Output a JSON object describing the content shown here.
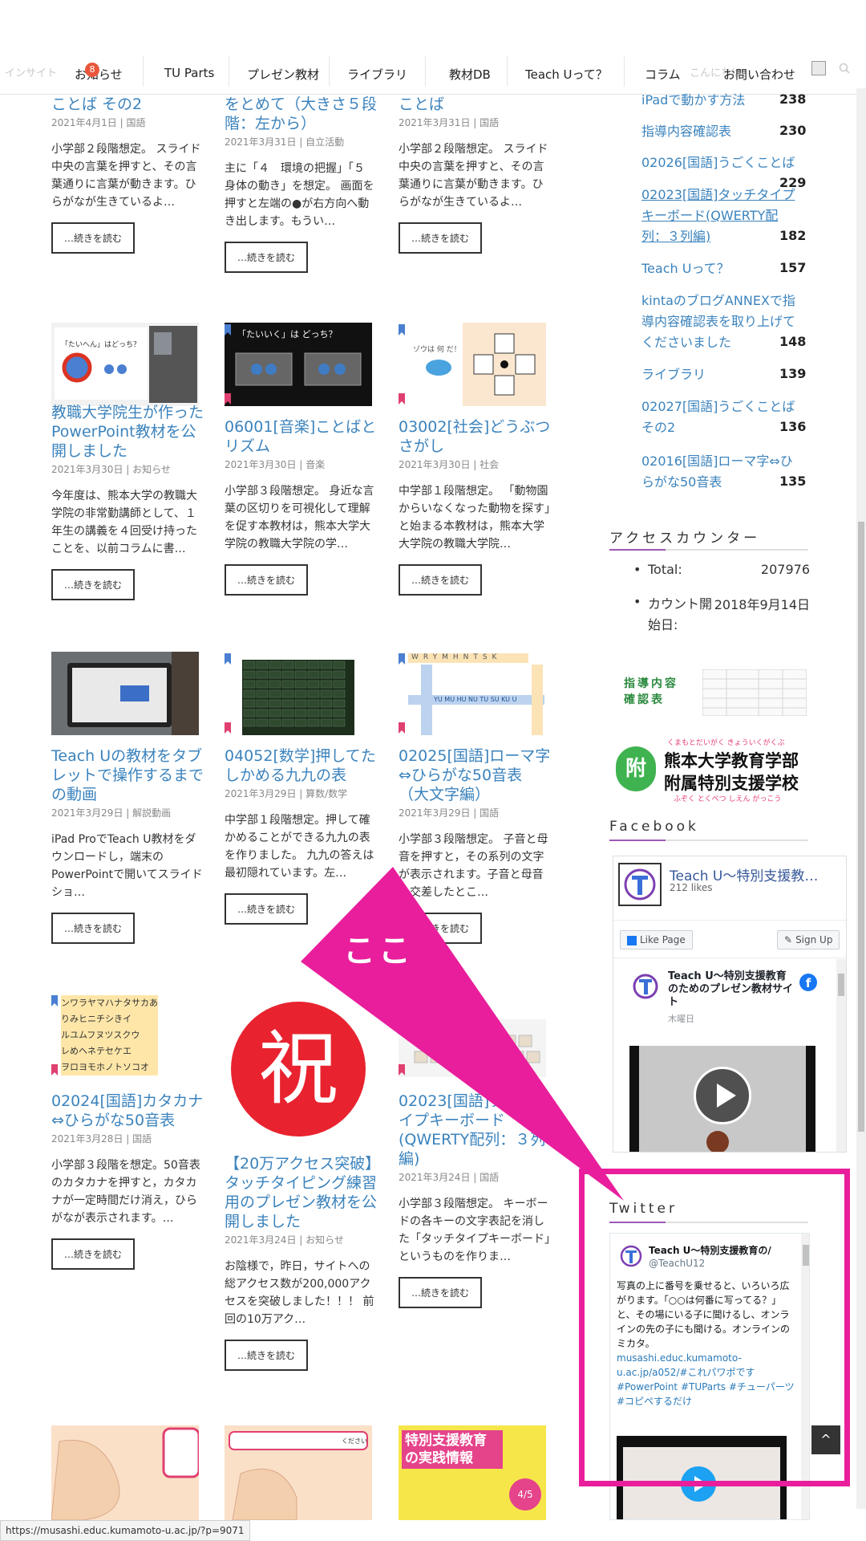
{
  "nav": {
    "items": [
      "お知らせ",
      "TU Parts",
      "プレゼン教材",
      "ライブラリ",
      "教材DB",
      "Teach Uって？",
      "コラム",
      "お問い合わせ"
    ],
    "badge": "8",
    "faint_left": "インサイト",
    "faint_right": "こんにちは、"
  },
  "posts": [
    {
      "title": "ことば その2",
      "date": "2021年4月1日",
      "cat": "国語",
      "excerpt": "小学部２段階想定。 スライド中央の言葉を押すと、その言葉通りに言葉が動きます。ひらがなが生きているよ…"
    },
    {
      "title": "をとめて（大きさ５段階：左から）",
      "date": "2021年3月31日",
      "cat": "自立活動",
      "excerpt": "主に「４　環境の把握」「５　身体の動き」を想定。 画面を押すと左端の●が右方向へ動き出します。もうい…"
    },
    {
      "title": "ことば",
      "date": "2021年3月31日",
      "cat": "国語",
      "excerpt": "小学部２段階想定。 スライド中央の言葉を押すと、その言葉通りに言葉が動きます。ひらがなが生きているよ…"
    },
    {
      "title": "教職大学院生が作ったPowerPoint教材を公開しました",
      "date": "2021年3月30日",
      "cat": "お知らせ",
      "excerpt": "今年度は、熊本大学の教職大学院の非常勤講師として、１年生の講義を４回受け持ったことを、以前コラムに書…"
    },
    {
      "title": "06001[音楽]ことばとリズム",
      "date": "2021年3月30日",
      "cat": "音楽",
      "excerpt": "小学部３段階想定。 身近な言葉の区切りを可視化して理解を促す本教材は，熊本大学大学院の教職大学院の学…"
    },
    {
      "title": "03002[社会]どうぶつさがし",
      "date": "2021年3月30日",
      "cat": "社会",
      "excerpt": "中学部１段階想定。 「動物園からいなくなった動物を探す」と始まる本教材は，熊本大学大学院の教職大学院…"
    },
    {
      "title": "Teach Uの教材をタブレットで操作するまでの動画",
      "date": "2021年3月29日",
      "cat": "解説動画",
      "excerpt": "iPad ProでTeach U教材をダウンロードし，端末のPowerPointで開いてスライドショ…"
    },
    {
      "title": "04052[数学]押してたしかめる九九の表",
      "date": "2021年3月29日",
      "cat": "算数/数学",
      "excerpt": "中学部１段階想定。押して確かめることができる九九の表を作りました。 九九の答えは最初隠れています。左…"
    },
    {
      "title": "02025[国語]ローマ字⇔ひらがな50音表（大文字編）",
      "date": "2021年3月29日",
      "cat": "国語",
      "excerpt": "小学部３段階想定。 子音と母音を押すと，その系列の文字が表示されます。子音と母音の交差したとこ…"
    },
    {
      "title": "02024[国語]カタカナ⇔ひらがな50音表",
      "date": "2021年3月28日",
      "cat": "国語",
      "excerpt": "小学部３段階を想定。50音表のカタカナを押すと，カタカナが一定時間だけ消え，ひらがなが表示されます。…"
    },
    {
      "title": "【20万アクセス突破】タッチタイピング練習用のプレゼン教材を公開しました",
      "date": "2021年3月24日",
      "cat": "お知らせ",
      "excerpt": "お陰様で，昨日，サイトへの総アクセス数が200,000アクセスを突破しました！！！ 前回の10万アク…"
    },
    {
      "title": "02023[国語]タッチタイプキーボード(QWERTY配列：３列編)",
      "date": "2021年3月24日",
      "cat": "国語",
      "excerpt": "小学部３段階想定。 キーボードの各キーの文字表記を消した「タッチタイプキーボード」というものを作りま…"
    }
  ],
  "read_more": "…続きを読む",
  "thumbs": {
    "t1_caption": "「たいへん」はどっち？",
    "t2_caption": "「たいいく」は どっち？",
    "t3_caption": "ゾウは 何 だ！",
    "iwai": "祝",
    "roma_top": "WRYMHNTSK",
    "roma_mid": "YU MU HU NU TU SU KU U",
    "kana_rows": [
      "ンワラヤマハナタサカあ",
      "りみヒニチシきイ",
      "ルユムフヌツスクウ",
      "レめヘネテセケエ",
      "ヲロヨモホノトソコオ"
    ],
    "bottom_bubble": "ください",
    "bottom_book": "特別支援教育の実践情報",
    "bottom_book_date": "4/5"
  },
  "sidebar": {
    "popular": [
      {
        "title": "iPadで動かす方法",
        "count": "238"
      },
      {
        "title": "指導内容確認表",
        "count": "230"
      },
      {
        "title": "02026[国語]うごくことば",
        "count": "229"
      },
      {
        "title": "02023[国語]タッチタイプキーボード(QWERTY配列：３列編)",
        "count": "182"
      },
      {
        "title": "Teach Uって？",
        "count": "157"
      },
      {
        "title": "kintaのブログANNEXで指導内容確認表を取り上げてくださいました",
        "count": "148"
      },
      {
        "title": "ライブラリ",
        "count": "139"
      },
      {
        "title": "02027[国語]うごくことば その2",
        "count": "136"
      },
      {
        "title": "02016[国語]ローマ字⇔ひらがな50音表",
        "count": "135"
      }
    ],
    "access_title": "アクセスカウンター",
    "total_label": "Total:",
    "total_value": "207976",
    "start_label": "カウント開始日:",
    "start_value": "2018年9月14日",
    "banner1": "指導内容確認表",
    "school_ruby": "くまもとだいがく きょういくがくぶ",
    "school_line1": "熊本大学教育学部",
    "school_line2": "附属特別支援学校",
    "school_ruby2": "ふぞく とくべつ しえん がっこう",
    "school_mark": "附",
    "facebook_title": "Facebook",
    "fb_page": "Teach U～特別支援教…",
    "fb_likes": "212 likes",
    "fb_like_btn": "Like Page",
    "fb_signup": "Sign Up",
    "fb_post_name": "Teach U～特別支援教育のためのプレゼン教材サイト",
    "fb_post_day": "木曜日",
    "twitter_title": "Twitter",
    "tw_name": "Teach U～特別支援教育の/",
    "tw_handle": "@TeachU12",
    "tw_text": "写真の上に番号を乗せると、いろいろ広がります。「○○は何番に写ってる？」と、その場にいる子に聞けるし、オンラインの先の子にも聞ける。オンラインのミカタ。",
    "tw_link": "musashi.educ.kumamoto-u.ac.jp/a052/#これパワポです",
    "tw_tags": "#PowerPoint #TUParts #チューパーツ #コピペするだけ"
  },
  "annotation": {
    "label": "ここ",
    "color": "#e91e9c"
  },
  "status_url": "https://musashi.educ.kumamoto-u.ac.jp/?p=9071",
  "colors": {
    "link": "#3b83bd",
    "accent": "#9b59b6",
    "magenta": "#e91e9c",
    "fb_blue": "#1877f2"
  }
}
